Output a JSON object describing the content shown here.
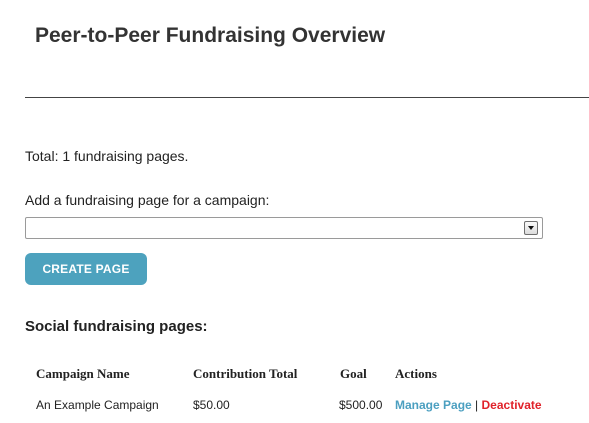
{
  "header": {
    "title": "Peer-to-Peer Fundraising Overview"
  },
  "summary": {
    "total_text": "Total: 1 fundraising pages."
  },
  "add_page": {
    "label": "Add a fundraising page for a campaign:",
    "select_value": "",
    "button_label": "CREATE PAGE"
  },
  "pages_section": {
    "heading": "Social fundraising pages:",
    "columns": [
      "Campaign Name",
      "Contribution Total",
      "Goal",
      "Actions"
    ],
    "rows": [
      {
        "campaign_name": "An Example Campaign",
        "contribution_total": "$50.00",
        "goal": "$500.00",
        "actions": {
          "manage": "Manage Page",
          "separator": "|",
          "deactivate": "Deactivate"
        }
      }
    ]
  },
  "colors": {
    "button_bg": "#4da2be",
    "manage_link": "#4b9fc0",
    "deactivate_link": "#e0222a"
  },
  "icons": {
    "select_arrow": "chevron-down-icon"
  }
}
